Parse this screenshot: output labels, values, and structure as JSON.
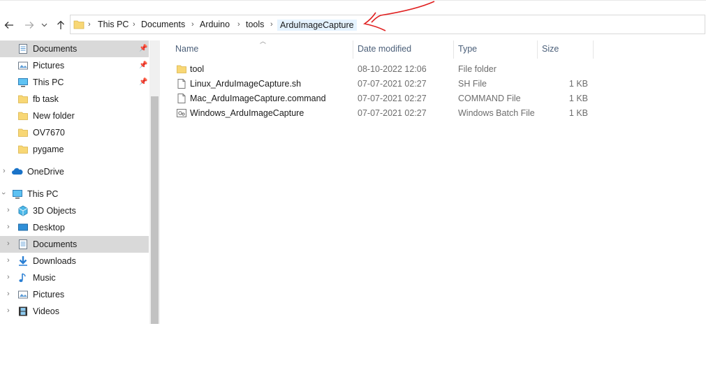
{
  "nav": {
    "back_icon": "arrow-left-icon",
    "forward_icon": "arrow-right-icon",
    "recent_icon": "chevron-down-icon",
    "up_icon": "arrow-up-icon"
  },
  "breadcrumb": [
    "This PC",
    "Documents",
    "Arduino",
    "tools",
    "ArduImageCapture"
  ],
  "sidebar": {
    "quick_access": [
      {
        "label": "Documents",
        "icon": "documents-icon",
        "pinned": true,
        "selected": true
      },
      {
        "label": "Pictures",
        "icon": "pictures-icon",
        "pinned": true
      },
      {
        "label": "This PC",
        "icon": "this-pc-icon",
        "pinned": true
      },
      {
        "label": "fb task",
        "icon": "folder-icon"
      },
      {
        "label": "New folder",
        "icon": "folder-icon"
      },
      {
        "label": "OV7670",
        "icon": "folder-icon"
      },
      {
        "label": "pygame",
        "icon": "folder-icon"
      }
    ],
    "onedrive": {
      "label": "OneDrive",
      "icon": "onedrive-icon"
    },
    "this_pc": {
      "label": "This PC",
      "icon": "this-pc-icon"
    },
    "this_pc_items": [
      {
        "label": "3D Objects",
        "icon": "3d-objects-icon"
      },
      {
        "label": "Desktop",
        "icon": "desktop-icon"
      },
      {
        "label": "Documents",
        "icon": "documents-icon",
        "selected": true
      },
      {
        "label": "Downloads",
        "icon": "downloads-icon"
      },
      {
        "label": "Music",
        "icon": "music-icon"
      },
      {
        "label": "Pictures",
        "icon": "pictures-icon"
      },
      {
        "label": "Videos",
        "icon": "videos-icon"
      }
    ]
  },
  "columns": {
    "name": "Name",
    "date": "Date modified",
    "type": "Type",
    "size": "Size"
  },
  "files": [
    {
      "name": "tool",
      "date": "08-10-2022 12:06",
      "type": "File folder",
      "size": "",
      "icon": "folder-icon"
    },
    {
      "name": "Linux_ArduImageCapture.sh",
      "date": "07-07-2021 02:27",
      "type": "SH File",
      "size": "1 KB",
      "icon": "file-icon"
    },
    {
      "name": "Mac_ArduImageCapture.command",
      "date": "07-07-2021 02:27",
      "type": "COMMAND File",
      "size": "1 KB",
      "icon": "file-icon"
    },
    {
      "name": "Windows_ArduImageCapture",
      "date": "07-07-2021 02:27",
      "type": "Windows Batch File",
      "size": "1 KB",
      "icon": "batch-file-icon"
    }
  ],
  "colors": {
    "selection": "#d9d9d9",
    "current_crumb": "#e5f3ff",
    "annotation": "#e02020",
    "folder": "#f8d775"
  }
}
